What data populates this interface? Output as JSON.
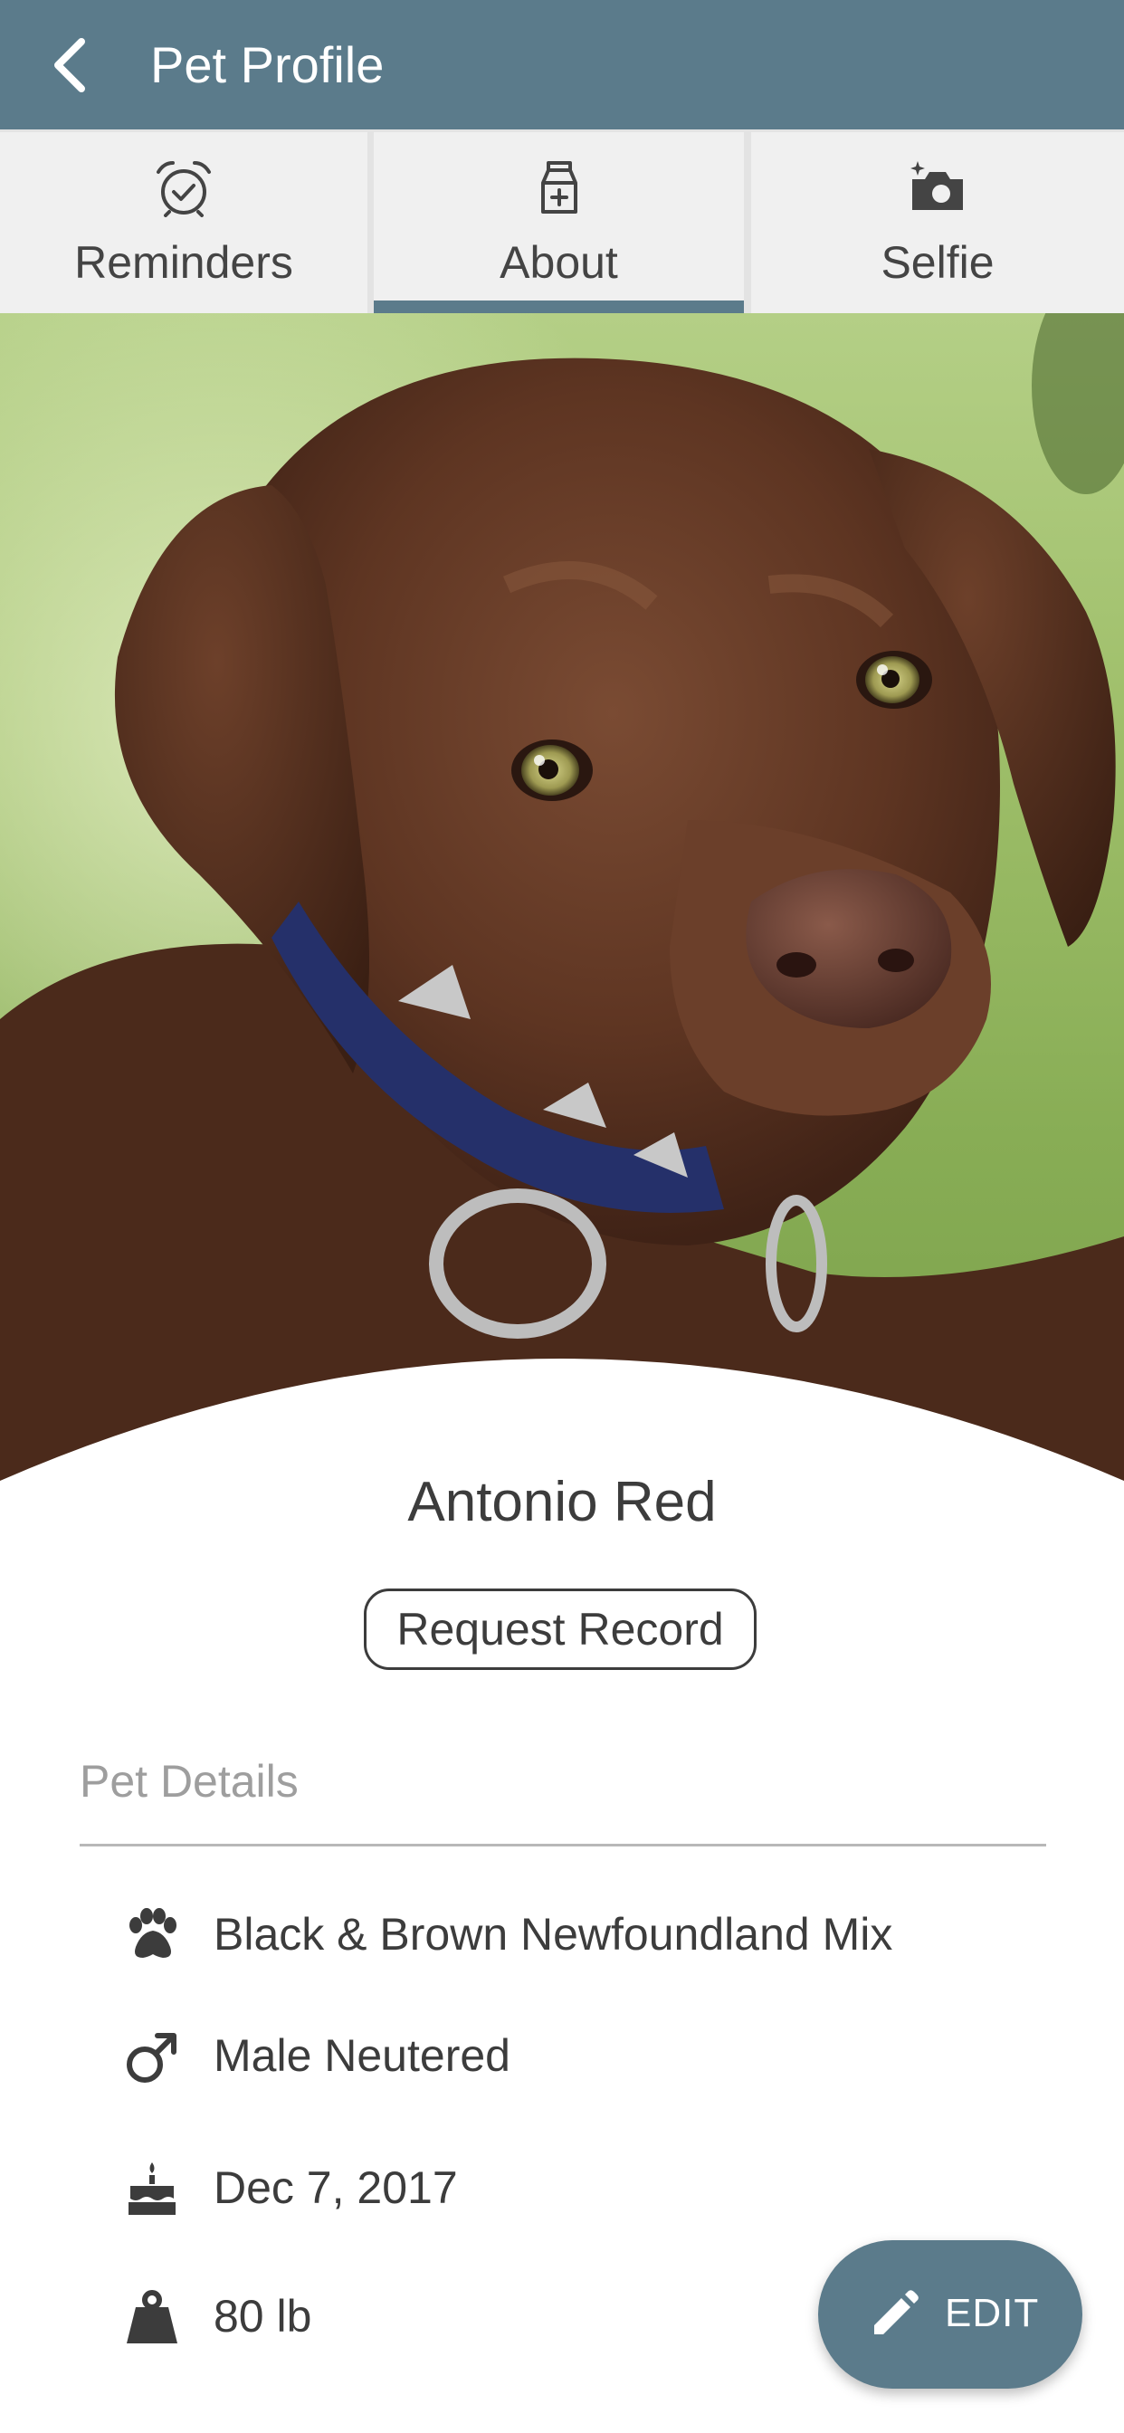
{
  "app_bar": {
    "title": "Pet Profile",
    "back_icon": "chevron-left-icon",
    "background": "#5b7b8b"
  },
  "tabs": [
    {
      "label": "Reminders",
      "icon": "alarm-check-icon",
      "selected": false
    },
    {
      "label": "About",
      "icon": "pet-food-bag-icon",
      "selected": true
    },
    {
      "label": "Selfie",
      "icon": "camera-sparkle-icon",
      "selected": false
    }
  ],
  "pet": {
    "name": "Antonio Red",
    "photo": "chocolate-labrador-puppy-photo"
  },
  "request_record": {
    "label": "Request Record"
  },
  "pet_details": {
    "heading": "Pet Details",
    "items": [
      {
        "icon": "paw-icon",
        "text": "Black & Brown Newfoundland Mix"
      },
      {
        "icon": "male-icon",
        "text": "Male Neutered"
      },
      {
        "icon": "birthday-cake-icon",
        "text": "Dec 7, 2017"
      },
      {
        "icon": "weight-icon",
        "text": "80 lb"
      }
    ]
  },
  "edit_button": {
    "label": "EDIT",
    "icon": "pencil-icon"
  },
  "colors": {
    "primary": "#5b7b8b",
    "text": "#3c3c3c",
    "muted": "#9e9e9e",
    "tab_background": "#f0f0f0"
  }
}
